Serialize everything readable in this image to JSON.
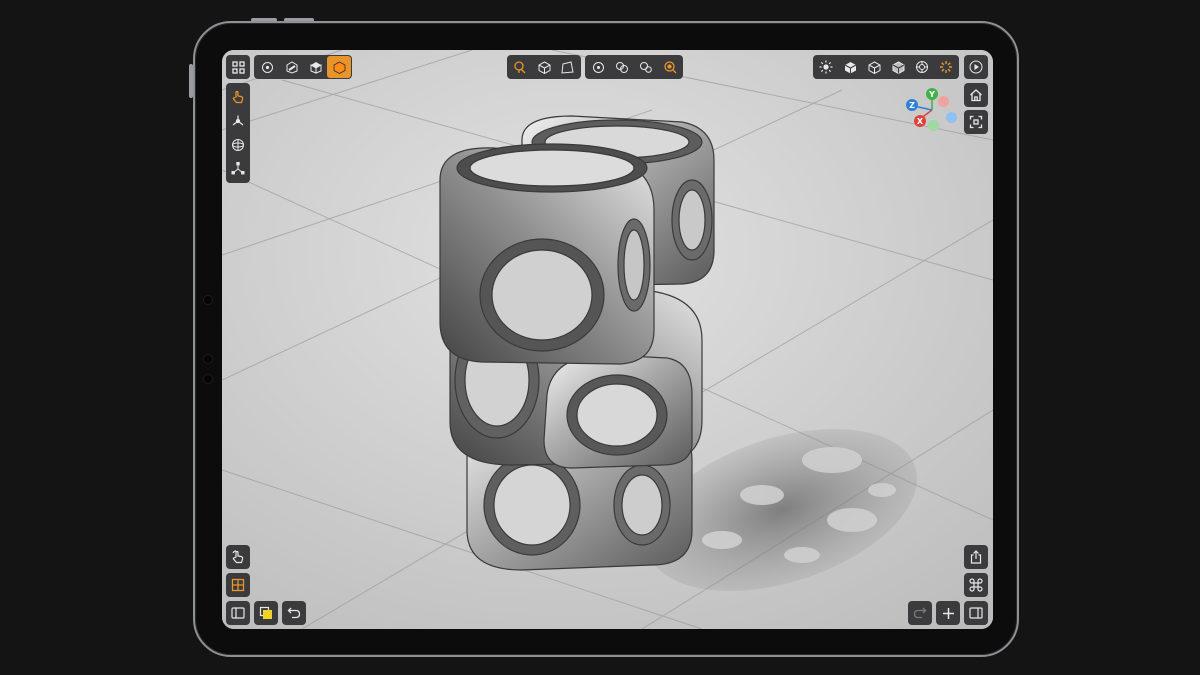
{
  "colors": {
    "accent": "#e8952b",
    "toolbar_bg": "#3b3b3d",
    "icon": "#e8e8e8",
    "axis_x": "#e0423b",
    "axis_y": "#43b04a",
    "axis_z": "#2f7fd8"
  },
  "top_left_toolbar": {
    "icons": [
      "grid-menu-icon",
      "vertex-mode-icon",
      "edge-mode-icon",
      "face-mode-icon",
      "object-mode-icon"
    ],
    "active": "object-mode-icon"
  },
  "top_center_toolbar": {
    "transform_icons": [
      "transform-gizmo-icon",
      "box-select-icon",
      "lasso-select-icon"
    ],
    "snap_icons": [
      "pivot-icon",
      "symmetry-icon",
      "boolean-icon",
      "snap-icon"
    ]
  },
  "top_right_toolbar": {
    "icons": [
      "lighting-icon",
      "solid-shading-icon",
      "wireframe-shading-icon",
      "material-shading-icon",
      "render-shading-icon",
      "loading-icon"
    ],
    "play_icon": "play-icon"
  },
  "left_toolbar": {
    "icons": [
      "touch-tool-icon",
      "move-axes-icon",
      "rotate-icon",
      "scale-axes-icon"
    ]
  },
  "right_toolbar": {
    "icons": [
      "home-view-icon",
      "frame-selection-icon"
    ]
  },
  "gizmo": {
    "x_label": "X",
    "y_label": "Y",
    "z_label": "Z"
  },
  "bottom_left": {
    "icons": [
      "gesture-icon",
      "grid-snap-icon",
      "sidebar-toggle-icon",
      "layers-icon",
      "undo-icon"
    ]
  },
  "bottom_right": {
    "icons": [
      "share-icon",
      "command-icon",
      "redo-icon",
      "add-icon",
      "panel-toggle-icon"
    ]
  }
}
